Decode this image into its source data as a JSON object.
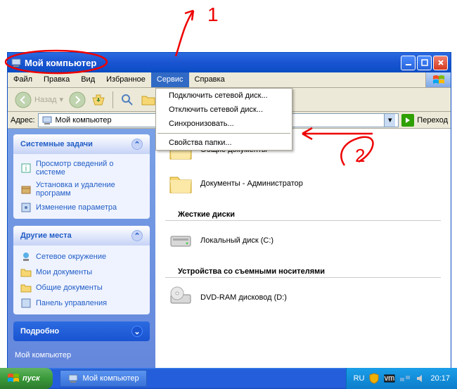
{
  "annotations": {
    "one": "1",
    "two": "2"
  },
  "titlebar": {
    "title": "Мой компьютер"
  },
  "menubar": {
    "items": [
      "Файл",
      "Правка",
      "Вид",
      "Избранное",
      "Сервис",
      "Справка"
    ],
    "open_index": 4
  },
  "dropdown": {
    "items": [
      "Подключить сетевой диск...",
      "Отключить сетевой диск...",
      "Синхронизовать..."
    ],
    "items2": [
      "Свойства папки..."
    ]
  },
  "toolbar": {
    "back_label": "Назад"
  },
  "addressbar": {
    "label": "Адрес:",
    "value": "Мой компьютер",
    "go": "Переход"
  },
  "sidebar": {
    "panel1": {
      "title": "Системные задачи",
      "links": [
        "Просмотр сведений о системе",
        "Установка и удаление программ",
        "Изменение параметра"
      ]
    },
    "panel2": {
      "title": "Другие места",
      "links": [
        "Сетевое окружение",
        "Мои документы",
        "Общие документы",
        "Панель управления"
      ]
    },
    "panel3": {
      "title": "Подробно"
    },
    "bottom": "Мой компьютер"
  },
  "main": {
    "items_top": [
      "Общие документы",
      "Документы - Администратор"
    ],
    "section_hdd": "Жесткие диски",
    "hdd": [
      "Локальный диск (C:)"
    ],
    "section_removable": "Устройства со съемными носителями",
    "removable": [
      "DVD-RAM дисковод (D:)"
    ]
  },
  "taskbar": {
    "start": "пуск",
    "task": "Мой компьютер",
    "lang": "RU",
    "clock": "20:17"
  }
}
